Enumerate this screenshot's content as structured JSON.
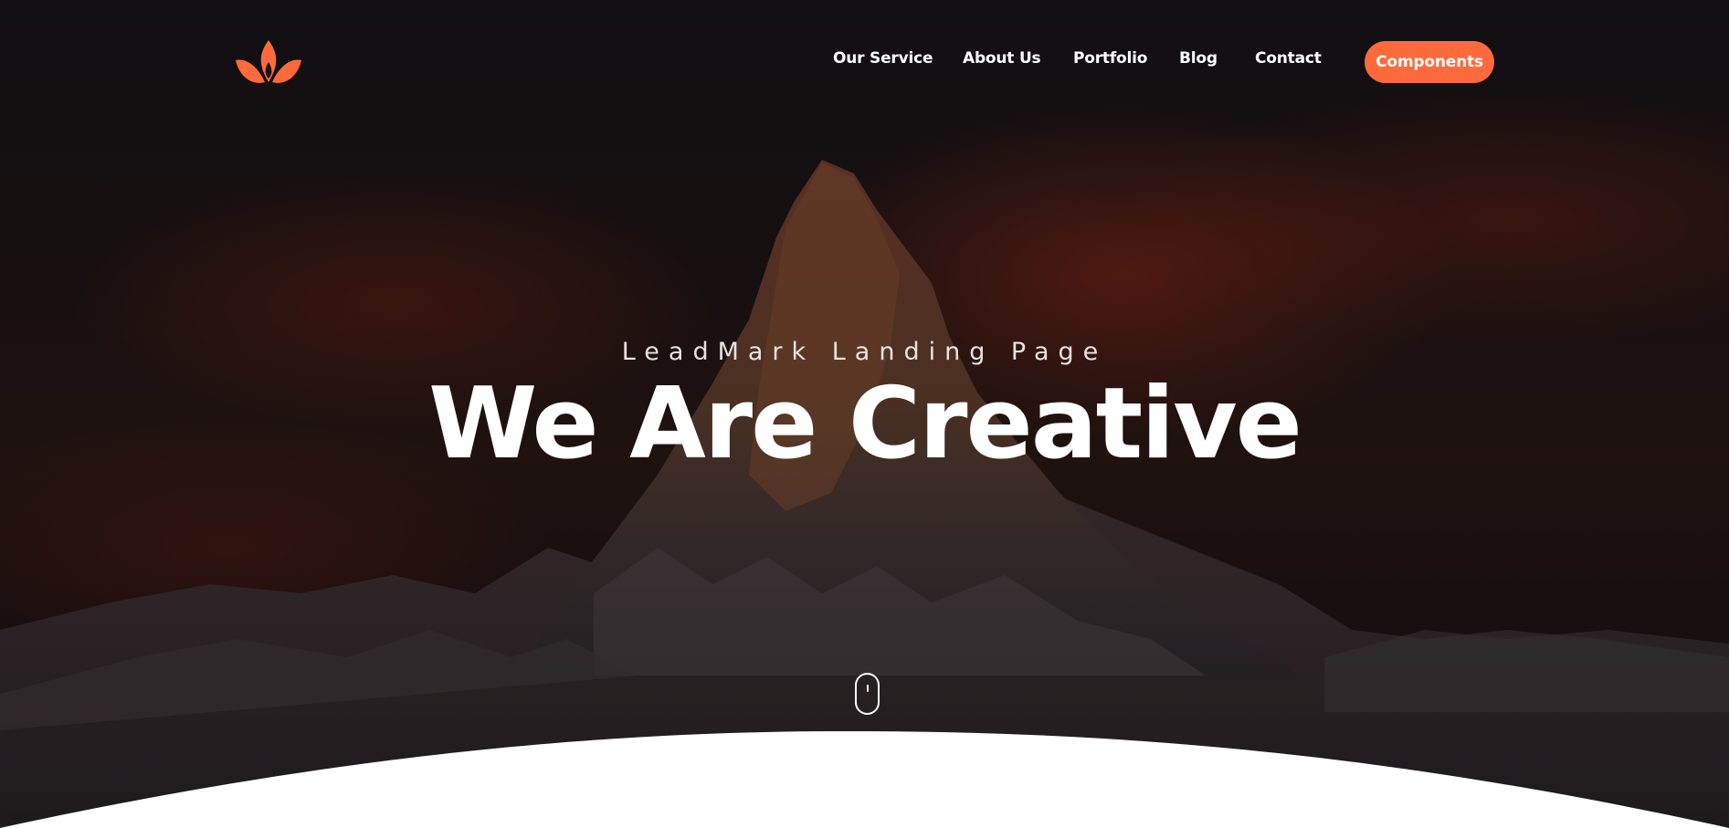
{
  "brand": {
    "logo_icon": "lotus-flame-icon",
    "accent_color": "#ff6a3d"
  },
  "nav": {
    "items": [
      {
        "label": "Our Service"
      },
      {
        "label": "About Us"
      },
      {
        "label": "Portfolio"
      },
      {
        "label": "Blog"
      },
      {
        "label": "Contact"
      }
    ],
    "cta_label": "Components"
  },
  "hero": {
    "subtitle": "LeadMark Landing Page",
    "title": "We Are Creative",
    "scroll_icon": "mouse-scroll-icon"
  }
}
